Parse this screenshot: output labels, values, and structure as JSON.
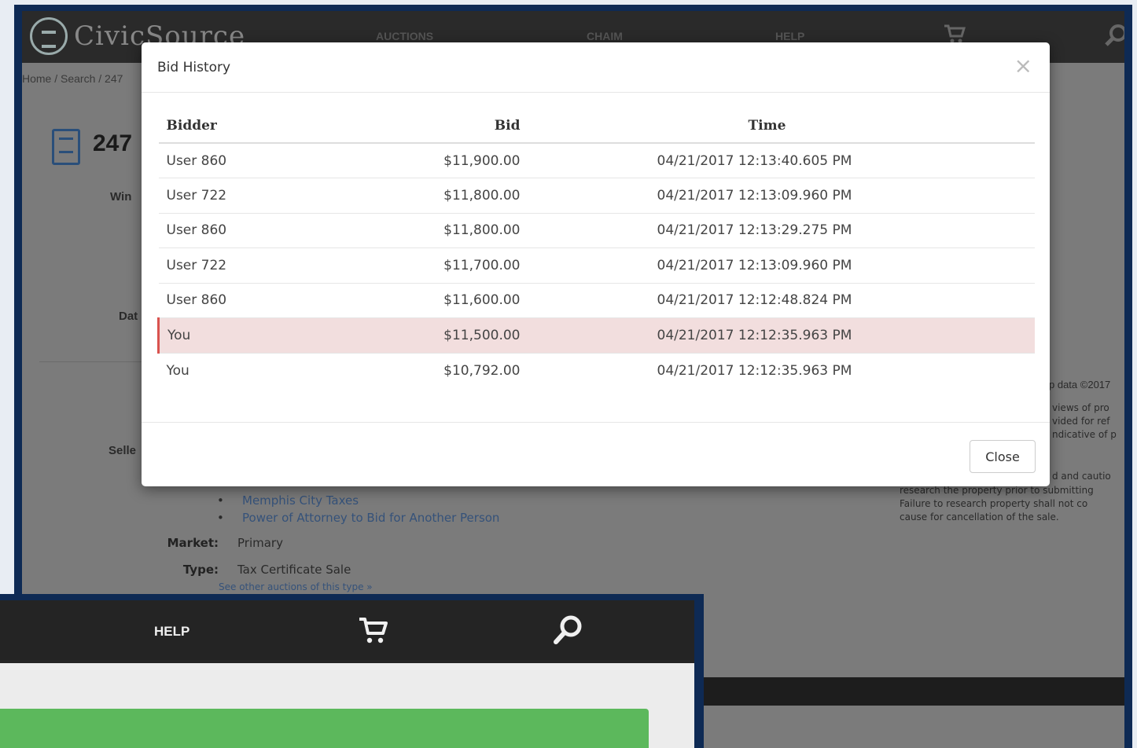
{
  "background_page": {
    "brand": "CivicSource",
    "nav": [
      "AUCTIONS",
      "CHAIM",
      "HELP"
    ],
    "breadcrumb": "Home / Search / 247",
    "title": "247",
    "labels": {
      "winner": "Win",
      "date": "Dat",
      "seller": "Selle"
    },
    "links": [
      "Memphis City Taxes",
      "Power of Attorney to Bid for Another Person"
    ],
    "market_label": "Market:",
    "market_value": "Primary",
    "type_label": "Type:",
    "type_value": "Tax Certificate Sale",
    "see_other": "See other auctions of this type »",
    "map_note": "p data ©2017",
    "disclaimer_lines": [
      "views of pro",
      "vided for ref",
      "ndicative of p",
      "d and cautio",
      "research the property prior to submitting",
      "Failure to research property shall not co",
      "cause for cancellation of the sale."
    ]
  },
  "modal": {
    "title": "Bid History",
    "close_icon": "×",
    "columns": {
      "bidder": "Bidder",
      "bid": "Bid",
      "time": "Time"
    },
    "rows": [
      {
        "bidder": "User 860",
        "bid": "$11,900.00",
        "time": "04/21/2017 12:13:40.605 PM"
      },
      {
        "bidder": "User 722",
        "bid": "$11,800.00",
        "time": "04/21/2017 12:13:09.960 PM"
      },
      {
        "bidder": "User 860",
        "bid": "$11,800.00",
        "time": "04/21/2017 12:13:29.275 PM"
      },
      {
        "bidder": "User 722",
        "bid": "$11,700.00",
        "time": "04/21/2017 12:13:09.960 PM"
      },
      {
        "bidder": "User 860",
        "bid": "$11,600.00",
        "time": "04/21/2017 12:12:48.824 PM"
      },
      {
        "bidder": "You",
        "bid": "$11,500.00",
        "time": "04/21/2017 12:12:35.963 PM"
      },
      {
        "bidder": "You",
        "bid": "$10,792.00",
        "time": "04/21/2017 12:12:35.963 PM"
      }
    ],
    "close_button": "Close"
  },
  "foreground": {
    "help": "HELP"
  },
  "colors": {
    "frame": "#0e2a54",
    "highlight_row": "#f2dede",
    "green_bar": "#5cb85c"
  }
}
